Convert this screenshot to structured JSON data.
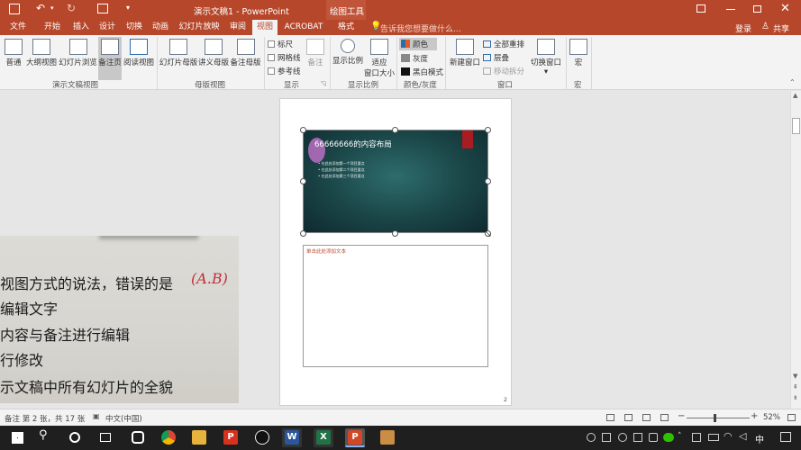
{
  "titlebar": {
    "doc_title": "演示文稿1 - PowerPoint",
    "context_tool": "绘图工具",
    "save_icon": "save-icon",
    "undo_icon": "undo-icon",
    "redo_icon": "redo-icon"
  },
  "tabs": {
    "items": [
      "文件",
      "开始",
      "插入",
      "设计",
      "切换",
      "动画",
      "幻灯片放映",
      "审阅",
      "视图",
      "ACROBAT",
      "格式"
    ],
    "active": "视图",
    "tell_me": "告诉我您想要做什么...",
    "login": "登录",
    "share": "共享"
  },
  "ribbon": {
    "views": [
      "普通",
      "大纲视图",
      "幻灯片浏览",
      "备注页",
      "阅读视图"
    ],
    "masters": [
      "幻灯片母版",
      "讲义母版",
      "备注母版"
    ],
    "show": [
      "标尺",
      "网格线",
      "参考线"
    ],
    "show_notes": "备注",
    "zoom": [
      "显示比例",
      "适应",
      "窗口大小"
    ],
    "color": [
      "颜色",
      "灰度",
      "黑白模式"
    ],
    "window_new": "新建窗口",
    "window_small": [
      "全部重排",
      "层叠",
      "移动拆分"
    ],
    "switch_window": "切换窗口",
    "macro": "宏",
    "groups": [
      "演示文稿视图",
      "母版视图",
      "显示",
      "显示比例",
      "颜色/灰度",
      "窗口",
      "宏"
    ]
  },
  "slide": {
    "title": "66666666的内容布局",
    "bullets": [
      "在此处添加第一个项目要点",
      "在此处添加第二个项目要点",
      "在此处添加第三个项目要点"
    ]
  },
  "notes": {
    "placeholder": "单击此处添加文本",
    "page_number": "2"
  },
  "photo": {
    "lines": [
      "视图方式的说法，错误的是",
      "编辑文字",
      "内容与备注进行编辑",
      "行修改",
      "示文稿中所有幻灯片的全貌"
    ],
    "handwriting": "(A.B)"
  },
  "statusbar": {
    "slide_info": "备注 第 2 张，共 17 张",
    "language": "中文(中国)",
    "zoom": "52%",
    "zoom_level": 0.52
  },
  "taskbar": {
    "apps": [
      "windows-start-icon",
      "search-icon",
      "task-view-icon",
      "multitasking-icon",
      "chrome-icon",
      "file-explorer-icon",
      "acrobat-icon",
      "qq-icon",
      "word-icon",
      "excel-icon",
      "powerpoint-icon",
      "mail-icon"
    ],
    "ime": "中"
  },
  "colors": {
    "accent": "#b7472a",
    "ribbon_bg": "#f3f3f3",
    "taskbar_bg": "#1f1f1f"
  }
}
